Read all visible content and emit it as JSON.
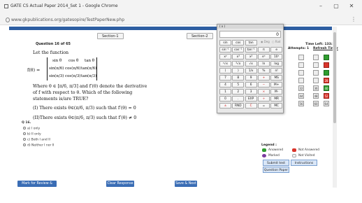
{
  "window": {
    "title": "GATE CS Actual Paper 2014_Set 1 - Google Chrome",
    "url": "www.gkpublications.org/gatesopire/TestPaperNew.php",
    "minimize": "–",
    "maximize": "▢",
    "close": "✕"
  },
  "sections": [
    "Section-1",
    "Section-2"
  ],
  "question": {
    "number_label": "Question 16 of 65",
    "intro": "Let the function",
    "f_label": "f(θ) =",
    "matrix": [
      [
        "sin θ",
        "cos θ",
        "tan θ"
      ],
      [
        "sin(π/6)",
        "cos(π/6)",
        "tan(π/6)"
      ],
      [
        "sin(π/3)",
        "cos(π/3)",
        "tan(π/3)"
      ]
    ],
    "where_line1": "Where θ ∈ [π/6, π/3] and f′(θ) denote the derivative",
    "where_line2": "of f with respect to θ. Which of the following",
    "where_line3": "statements is/are TRUE?",
    "stmt1": "(I) There exists θ∈(π/6, π/3) such that f′(θ) = 0",
    "stmt2": "(II)There exists θ∈(π/6, π/3) such that f′(θ) ≠ 0",
    "ans_label": "Q 16.",
    "options": [
      "a) I only",
      "b) II only",
      "c) Both I and II",
      "d) Neither I nor II"
    ]
  },
  "bottom_buttons": {
    "mark_review": "Mark for Review & Next",
    "clear": "Clear Response",
    "save_next": "Save & Next"
  },
  "right_panel": {
    "time_left": "Time Left: 133:25",
    "attempts": "Attempts: 1",
    "refresh": "Refresh Timer",
    "legend_title": "Legend :",
    "legend": {
      "answered": "Answered",
      "not_answered": "Not Answered",
      "marked": "Marked",
      "not_visited": "Not Visited"
    },
    "submit": "Submit test",
    "instructions": "Instructions",
    "question_paper": "Question Paper",
    "grid_numbers": [
      "",
      "",
      "",
      "",
      "",
      "",
      "",
      "",
      "",
      "",
      "",
      "28",
      "32",
      "36",
      "40",
      "44",
      "48",
      "52",
      "56",
      "60",
      "64"
    ],
    "answered_color": "#2f9d2f",
    "not_answered_color": "#d9342b"
  },
  "calculator": {
    "title": "( x )",
    "display": "0",
    "deg_label": "Deg",
    "rad_label": "Rad",
    "rows": [
      [
        "sin",
        "cos",
        "tan",
        "",
        ""
      ],
      [
        "sin⁻¹",
        "cos⁻¹",
        "tan⁻¹",
        "π",
        "e"
      ],
      [
        "xʸ",
        "x³",
        "x²",
        "eˣ",
        "10ˣ"
      ],
      [
        "ʸ√x",
        "³√x",
        "√x",
        "ln",
        "log"
      ],
      [
        "(",
        ")",
        "1/x",
        "%",
        "n!"
      ],
      [
        "7",
        "8",
        "9",
        "+",
        "MS"
      ],
      [
        "4",
        "5",
        "6",
        "−",
        "M+"
      ],
      [
        "1",
        "2",
        "3",
        "×",
        "M-"
      ],
      [
        "0",
        ".",
        "EXP",
        "÷",
        "MR"
      ],
      [
        "±",
        "RND",
        "C",
        "=",
        "MC"
      ]
    ]
  }
}
